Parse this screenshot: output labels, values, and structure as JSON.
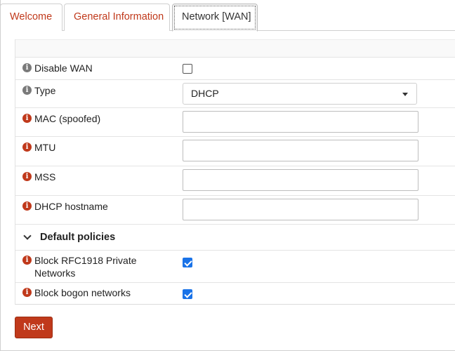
{
  "tabs": [
    {
      "label": "Welcome",
      "active": false
    },
    {
      "label": "General Information",
      "active": false
    },
    {
      "label": "Network [WAN]",
      "active": true
    }
  ],
  "form": {
    "disable_wan": {
      "label": "Disable WAN",
      "checked": false
    },
    "type": {
      "label": "Type",
      "value": "DHCP"
    },
    "mac": {
      "label": "MAC (spoofed)",
      "value": ""
    },
    "mtu": {
      "label": "MTU",
      "value": ""
    },
    "mss": {
      "label": "MSS",
      "value": ""
    },
    "dhcp_hostname": {
      "label": "DHCP hostname",
      "value": ""
    },
    "policies_section": {
      "title": "Default policies"
    },
    "block_rfc1918": {
      "label": "Block RFC1918 Private Networks",
      "checked": true
    },
    "block_bogon": {
      "label": "Block bogon networks",
      "checked": true
    }
  },
  "icons": {
    "info": "info-icon",
    "expand": "chevron-down-icon"
  },
  "actions": {
    "next_label": "Next"
  },
  "colors": {
    "accent": "#c0391b",
    "checkbox_checked": "#1a73e8"
  }
}
